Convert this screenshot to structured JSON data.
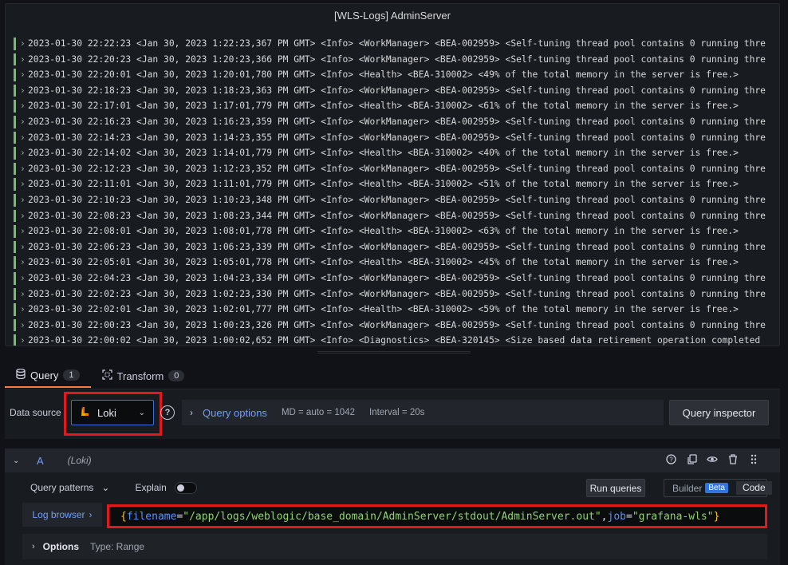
{
  "panel": {
    "title": "[WLS-Logs] AdminServer",
    "logs": [
      "2023-01-30 22:22:23 <Jan 30, 2023 1:22:23,367 PM GMT> <Info> <WorkManager> <BEA-002959> <Self-tuning thread pool contains 0 running thre",
      "2023-01-30 22:20:23 <Jan 30, 2023 1:20:23,366 PM GMT> <Info> <WorkManager> <BEA-002959> <Self-tuning thread pool contains 0 running thre",
      "2023-01-30 22:20:01 <Jan 30, 2023 1:20:01,780 PM GMT> <Info> <Health> <BEA-310002> <49% of the total memory in the server is free.>",
      "2023-01-30 22:18:23 <Jan 30, 2023 1:18:23,363 PM GMT> <Info> <WorkManager> <BEA-002959> <Self-tuning thread pool contains 0 running thre",
      "2023-01-30 22:17:01 <Jan 30, 2023 1:17:01,779 PM GMT> <Info> <Health> <BEA-310002> <61% of the total memory in the server is free.>",
      "2023-01-30 22:16:23 <Jan 30, 2023 1:16:23,359 PM GMT> <Info> <WorkManager> <BEA-002959> <Self-tuning thread pool contains 0 running thre",
      "2023-01-30 22:14:23 <Jan 30, 2023 1:14:23,355 PM GMT> <Info> <WorkManager> <BEA-002959> <Self-tuning thread pool contains 0 running thre",
      "2023-01-30 22:14:02 <Jan 30, 2023 1:14:01,779 PM GMT> <Info> <Health> <BEA-310002> <40% of the total memory in the server is free.>",
      "2023-01-30 22:12:23 <Jan 30, 2023 1:12:23,352 PM GMT> <Info> <WorkManager> <BEA-002959> <Self-tuning thread pool contains 0 running thre",
      "2023-01-30 22:11:01 <Jan 30, 2023 1:11:01,779 PM GMT> <Info> <Health> <BEA-310002> <51% of the total memory in the server is free.>",
      "2023-01-30 22:10:23 <Jan 30, 2023 1:10:23,348 PM GMT> <Info> <WorkManager> <BEA-002959> <Self-tuning thread pool contains 0 running thre",
      "2023-01-30 22:08:23 <Jan 30, 2023 1:08:23,344 PM GMT> <Info> <WorkManager> <BEA-002959> <Self-tuning thread pool contains 0 running thre",
      "2023-01-30 22:08:01 <Jan 30, 2023 1:08:01,778 PM GMT> <Info> <Health> <BEA-310002> <63% of the total memory in the server is free.>",
      "2023-01-30 22:06:23 <Jan 30, 2023 1:06:23,339 PM GMT> <Info> <WorkManager> <BEA-002959> <Self-tuning thread pool contains 0 running thre",
      "2023-01-30 22:05:01 <Jan 30, 2023 1:05:01,778 PM GMT> <Info> <Health> <BEA-310002> <45% of the total memory in the server is free.>",
      "2023-01-30 22:04:23 <Jan 30, 2023 1:04:23,334 PM GMT> <Info> <WorkManager> <BEA-002959> <Self-tuning thread pool contains 0 running thre",
      "2023-01-30 22:02:23 <Jan 30, 2023 1:02:23,330 PM GMT> <Info> <WorkManager> <BEA-002959> <Self-tuning thread pool contains 0 running thre",
      "2023-01-30 22:02:01 <Jan 30, 2023 1:02:01,777 PM GMT> <Info> <Health> <BEA-310002> <59% of the total memory in the server is free.>",
      "2023-01-30 22:00:23 <Jan 30, 2023 1:00:23,326 PM GMT> <Info> <WorkManager> <BEA-002959> <Self-tuning thread pool contains 0 running thre",
      "2023-01-30 22:00:02 <Jan 30, 2023 1:00:02,652 PM GMT> <Info> <Diagnostics> <BEA-320145> <Size based data retirement operation completed"
    ],
    "log_level_color": "#73bf69"
  },
  "tabs": [
    {
      "label": "Query",
      "count": "1",
      "icon": "database-icon"
    },
    {
      "label": "Transform",
      "count": "0",
      "icon": "transform-icon"
    }
  ],
  "toolbar": {
    "datasource_label": "Data source",
    "datasource_value": "Loki",
    "query_options_label": "Query options",
    "md_text": "MD = auto = 1042",
    "interval_text": "Interval = 20s",
    "inspector_label": "Query inspector"
  },
  "query": {
    "letter": "A",
    "datasource": "(Loki)",
    "patterns_label": "Query patterns",
    "explain_label": "Explain",
    "run_label": "Run queries",
    "builder_label": "Builder",
    "beta_label": "Beta",
    "code_label": "Code",
    "log_browser_label": "Log browser",
    "expr": {
      "open": "{",
      "k1": "filename",
      "eq1": "=",
      "v1": "\"/app/logs/weblogic/base_domain/AdminServer/stdout/AdminServer.out\"",
      "comma": ",",
      "k2": "job",
      "eq2": "=",
      "v2": "\"grafana-wls\"",
      "close": "}"
    },
    "options_label": "Options",
    "options_type": "Type: Range"
  },
  "colors": {
    "accent": "#6e9fff",
    "highlight": "#e01a1a",
    "active_tab": "#ff7a3e"
  }
}
